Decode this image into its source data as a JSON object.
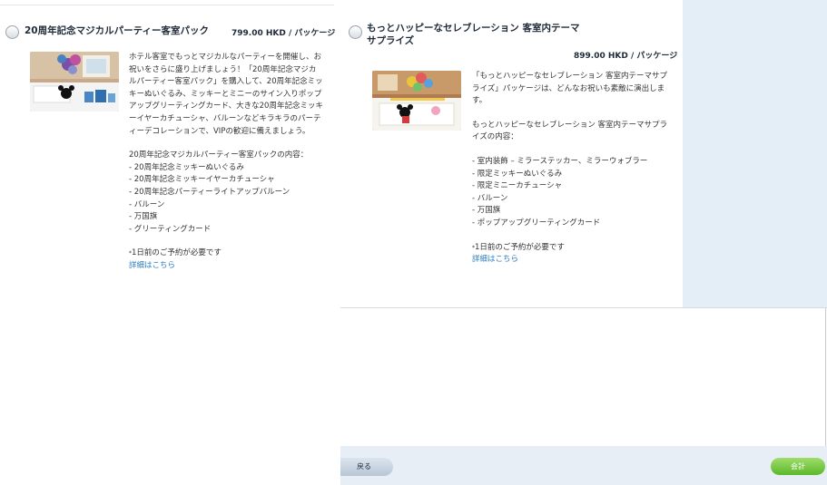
{
  "packages": [
    {
      "title": "20周年記念マジカルパーティー客室パック",
      "price": "799.00 HKD / パッケージ",
      "description": "ホテル客室でもっとマジカルなパーティーを開催し、お祝いをさらに盛り上げましょう！「20周年記念マジカルパーティー客室パック」を購入して、20周年記念ミッキーぬいぐるみ、ミッキーとミニーのサイン入りポップアップグリーティングカード、大きな20周年記念ミッキーイヤーカチューシャ、バルーンなどキラキラのパーティーデコレーションで、VIPの歓迎に備えましょう。",
      "contents_heading": "20周年記念マジカルパーティー客室パックの内容：",
      "items": [
        "- 20周年記念ミッキーぬいぐるみ",
        "- 20周年記念ミッキーイヤーカチューシャ",
        "- 20周年記念パーティーライトアップバルーン",
        "- バルーン",
        "- 万国旗",
        "- グリーティングカード"
      ],
      "note_mark": "*",
      "note": "1日前のご予約が必要です",
      "link": "詳細はこちら"
    },
    {
      "title": "もっとハッピーなセレブレーション 客室内テーマサプライズ",
      "price": "899.00 HKD / パッケージ",
      "description": "「もっとハッピーなセレブレーション 客室内テーマサプライズ」パッケージは、どんなお祝いも素敵に演出します。",
      "contents_heading": "もっとハッピーなセレブレーション 客室内テーマサプライズの内容：",
      "items": [
        "- 室内装飾 – ミラーステッカー、ミラーウォブラー",
        "- 限定ミッキーぬいぐるみ",
        "- 限定ミニーカチューシャ",
        "- バルーン",
        "- 万国旗",
        "- ポップアップグリーティングカード"
      ],
      "note_mark": "*",
      "note": "1日前のご予約が必要です",
      "link": "詳細はこちら"
    }
  ],
  "footer": {
    "back_label": "戻る",
    "total_label": "会計"
  },
  "colors": {
    "accent_link": "#2a7dc0",
    "total_button": "#5cb82a",
    "side_panel": "#e4eef7"
  }
}
